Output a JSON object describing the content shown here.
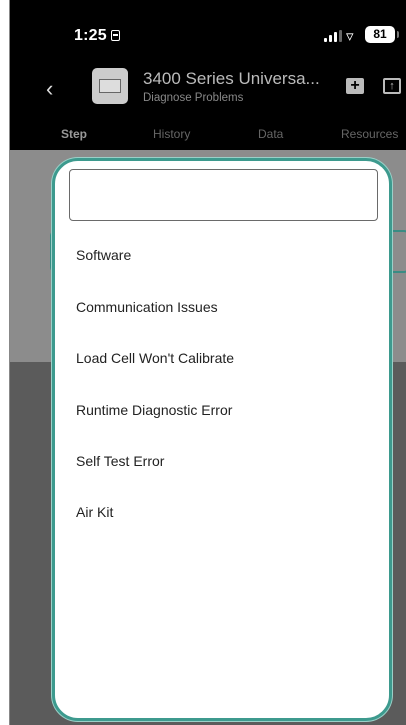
{
  "status_bar": {
    "time": "1:25",
    "battery": "81"
  },
  "app_bar": {
    "title": "3400 Series Universa...",
    "subtitle": "Diagnose Problems",
    "icons": [
      "back-icon",
      "device-thumbnail",
      "add-icon",
      "share-icon"
    ]
  },
  "tabs": [
    "Step",
    "History",
    "Data",
    "Resources"
  ],
  "active_tab": "Step",
  "picker": {
    "search_value": "",
    "options": [
      "Software",
      "Communication Issues",
      "Load Cell Won't Calibrate",
      "Runtime Diagnostic Error",
      "Self Test Error",
      "Air Kit"
    ]
  },
  "colors": {
    "accent": "#3d9a8e",
    "header_bg": "#000000",
    "overlay": "#5b5b5b"
  }
}
